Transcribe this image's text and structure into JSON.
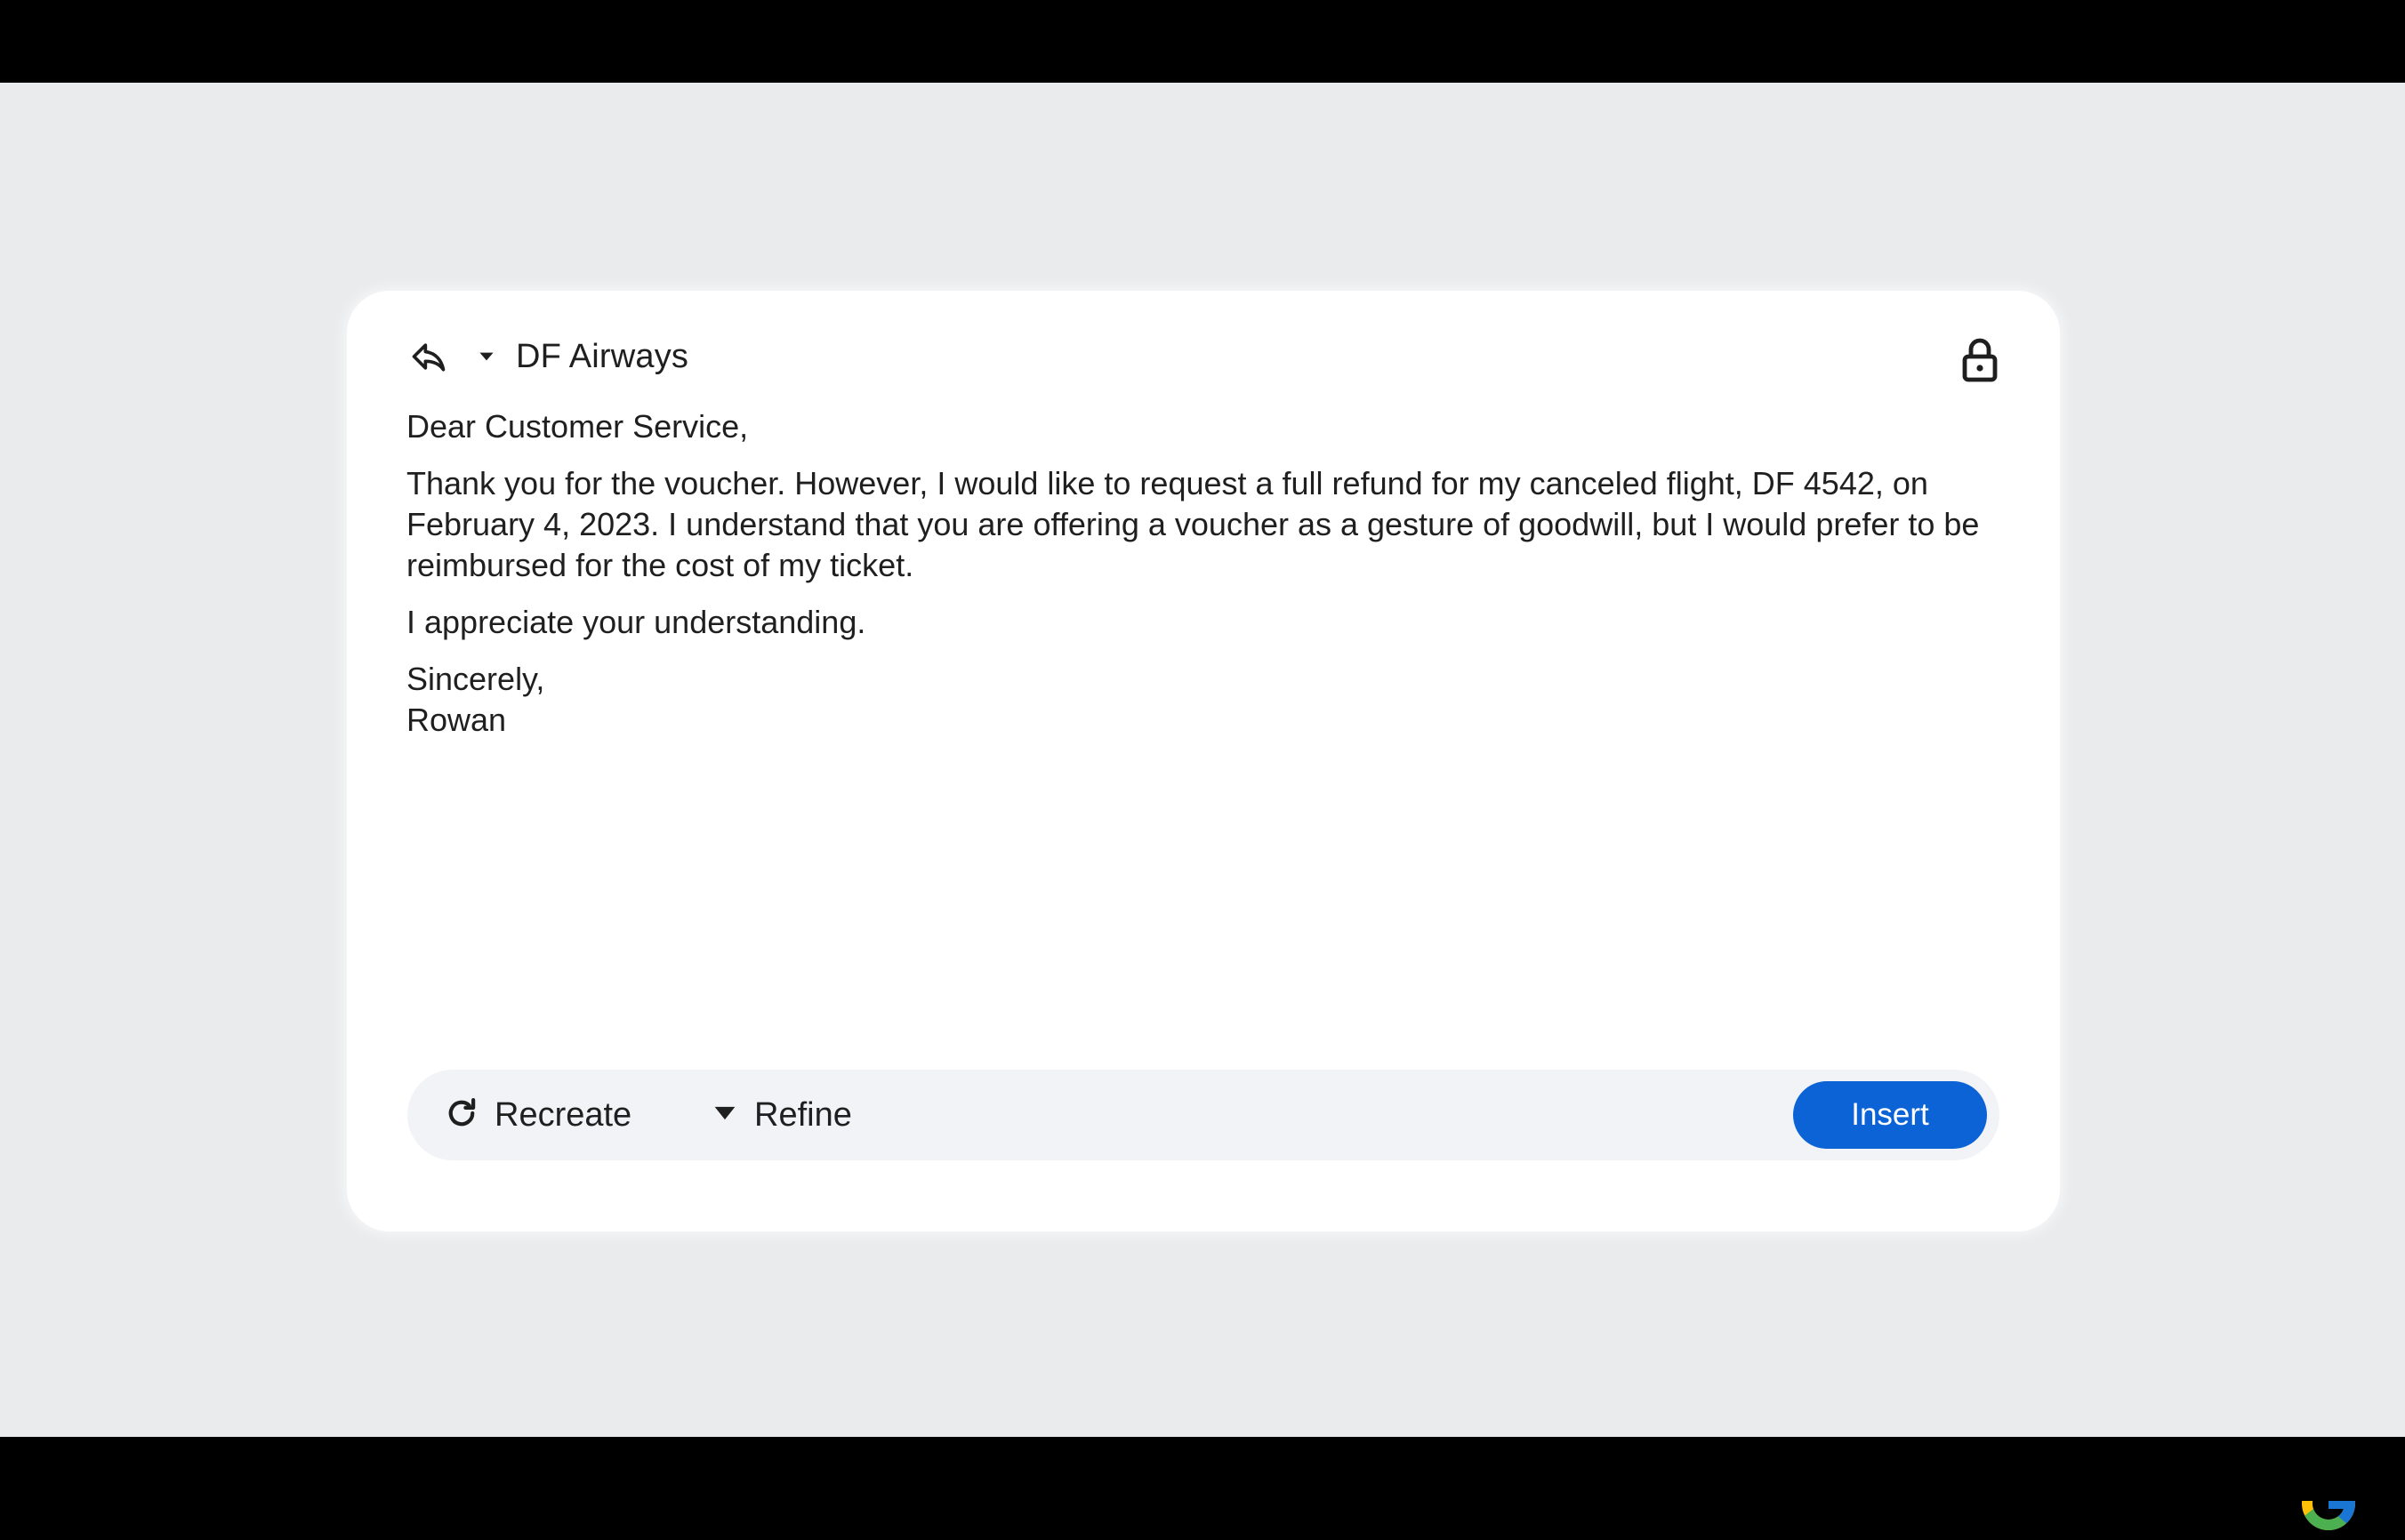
{
  "compose": {
    "recipient": "DF Airways",
    "body": {
      "greeting": "Dear Customer Service,",
      "paragraph1_line1": "Thank you for the voucher. However, I would like to request a full refund for my canceled flight, DF 4542, on",
      "paragraph1_line2": "February 4, 2023. I understand that you are offering a voucher as a gesture of goodwill, but I would prefer to be",
      "paragraph1_line3": "reimbursed for the cost of my ticket.",
      "paragraph2": "I appreciate your understanding.",
      "closing": "Sincerely,",
      "signature": "Rowan"
    }
  },
  "actions": {
    "recreate_label": "Recreate",
    "refine_label": "Refine",
    "insert_label": "Insert"
  },
  "icons": {
    "reply": "reply-icon",
    "caret": "caret-down-icon",
    "lock": "lock-icon",
    "recreate": "refresh-icon",
    "refine": "caret-down-icon",
    "brand": "google-g-logo"
  },
  "colors": {
    "accent": "#0b63d6",
    "background": "#e9ebed",
    "card": "#ffffff",
    "action_bar": "#f1f3f6",
    "text": "#1f1f1f"
  }
}
